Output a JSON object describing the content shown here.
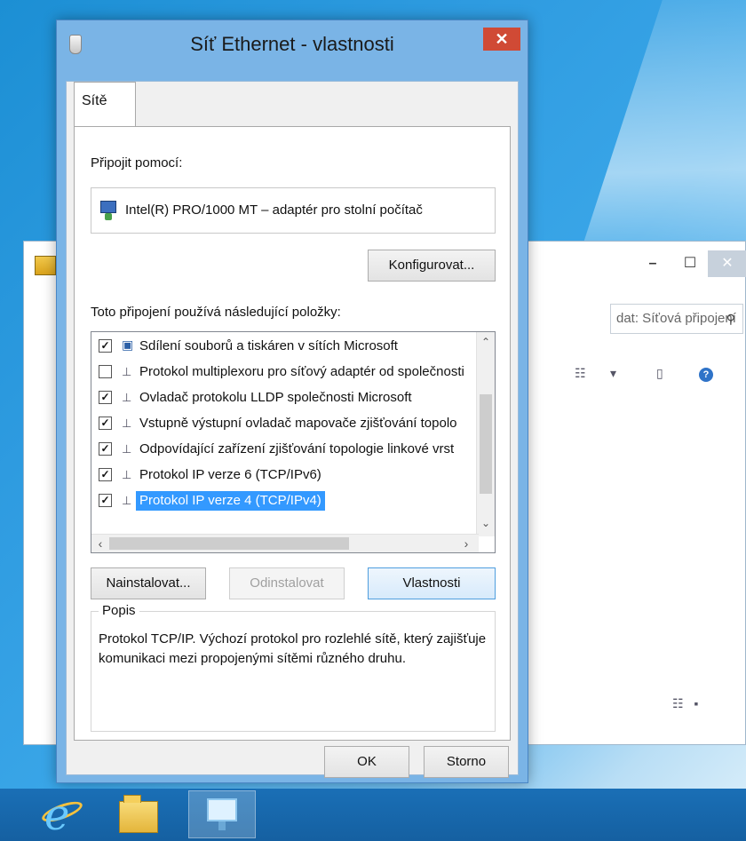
{
  "dialog": {
    "title": "Síť Ethernet - vlastnosti",
    "close_symbol": "✕",
    "tab_label": "Sítě",
    "connect_using_label": "Připojit pomocí:",
    "adapter_name": "Intel(R) PRO/1000 MT – adaptér pro stolní počítač",
    "configure_button": "Konfigurovat...",
    "items_label": "Toto připojení používá následující položky:",
    "items": [
      {
        "label": "Sdílení souborů a tiskáren v sítích Microsoft",
        "checked": true,
        "icon": "share-icon"
      },
      {
        "label": "Protokol multiplexoru pro síťový adaptér od společnosti",
        "checked": false,
        "icon": "protocol-icon"
      },
      {
        "label": "Ovladač protokolu LLDP společnosti Microsoft",
        "checked": true,
        "icon": "protocol-icon"
      },
      {
        "label": "Vstupně výstupní ovladač mapovače zjišťování topolo",
        "checked": true,
        "icon": "protocol-icon"
      },
      {
        "label": "Odpovídající zařízení zjišťování topologie linkové vrst",
        "checked": true,
        "icon": "protocol-icon"
      },
      {
        "label": "Protokol IP verze 6 (TCP/IPv6)",
        "checked": true,
        "icon": "protocol-icon"
      },
      {
        "label": "Protokol IP verze 4 (TCP/IPv4)",
        "checked": true,
        "icon": "protocol-icon",
        "selected": true
      }
    ],
    "install_button": "Nainstalovat...",
    "uninstall_button": "Odinstalovat",
    "properties_button": "Vlastnosti",
    "description_title": "Popis",
    "description_text": "Protokol TCP/IP. Výchozí protokol pro rozlehlé sítě, který zajišťuje komunikaci mezi propojenými sítěmi různého druhu.",
    "ok_button": "OK",
    "cancel_button": "Storno"
  },
  "explorer": {
    "search_placeholder": "dat: Síťová připojení",
    "minimize_symbol": "–",
    "maximize_symbol": "☐",
    "close_symbol": "✕"
  },
  "taskbar": {
    "items": [
      "internet-explorer-icon",
      "file-explorer-icon",
      "network-connections-icon"
    ]
  },
  "colors": {
    "selection": "#3399ff",
    "close_button": "#d04a35",
    "dialog_frame": "#7ab4e6",
    "taskbar": "#1560a1"
  }
}
